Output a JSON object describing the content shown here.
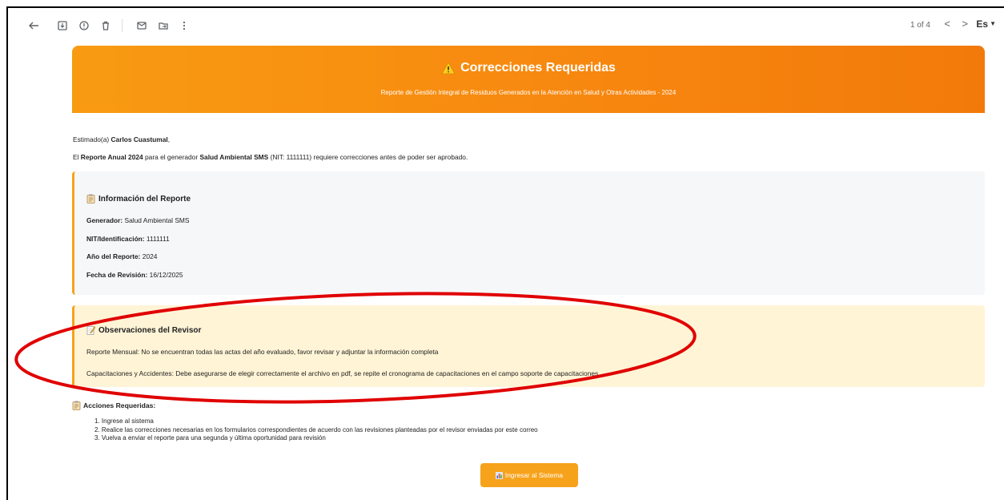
{
  "toolbar": {
    "icons": [
      "back-icon",
      "archive-icon",
      "report-spam-icon",
      "delete-icon",
      "mark-unread-icon",
      "move-to-icon",
      "more-icon"
    ],
    "pager": "1 of 4",
    "prev": "<",
    "next": ">",
    "lang": "Es"
  },
  "banner": {
    "title": "Correcciones Requeridas",
    "subtitle": "Reporte de Gestión Integral de Residuos Generados en la Atención en Salud y Otras Actividades - 2024"
  },
  "greeting": {
    "prefix": "Estimado(a)",
    "name": "Carlos Cuastumal",
    "suffix": ","
  },
  "intro": {
    "part1": "El",
    "report": "Reporte Anual 2024",
    "part2": "para el generador",
    "generator": "Salud Ambiental SMS",
    "part3": "(NIT: 1111111) requiere correcciones antes de poder ser aprobado."
  },
  "info": {
    "title": "Información del Reporte",
    "rows": [
      {
        "label": "Generador:",
        "value": "Salud Ambiental SMS"
      },
      {
        "label": "NIT/Identificación:",
        "value": "1111111"
      },
      {
        "label": "Año del Reporte:",
        "value": "2024"
      },
      {
        "label": "Fecha de Revisión:",
        "value": "16/12/2025"
      }
    ]
  },
  "observations": {
    "title": "Observaciones del Revisor",
    "lines": [
      "Reporte Mensual: No se encuentran todas las actas del año evaluado, favor revisar y adjuntar la información completa",
      "Capacitaciones y Accidentes: Debe asegurarse de elegir correctamente el archivo en pdf, se repite el cronograma de capacitaciones en el campo soporte de capacitaciones"
    ]
  },
  "actions": {
    "title": "Acciones Requeridas:",
    "steps": [
      "1. Ingrese al sistema",
      "2. Realice las correcciones necesarias en los formularios correspondientes de acuerdo con las revisiones planteadas por el revisor enviadas por este correo",
      "3. Vuelva a enviar el reporte para una segunda y última oportunidad para revisión"
    ]
  },
  "button": {
    "label": "Ingresar al Sistema"
  },
  "colors": {
    "accent": "#f7a21b",
    "banner": "#f7860f",
    "info_bg": "#f6f7f9",
    "obs_bg": "#fff4d6",
    "highlight": "#e00000"
  }
}
